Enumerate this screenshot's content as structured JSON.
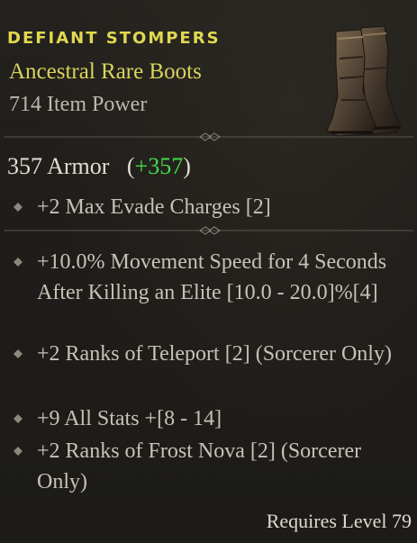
{
  "item": {
    "name": "DEFIANT STOMPERS",
    "type": "Ancestral Rare Boots",
    "power": "714 Item Power",
    "image_icon": "boots-icon"
  },
  "armor": {
    "value": "357 Armor",
    "bonus_open": "(",
    "bonus_value": "+357",
    "bonus_close": ")"
  },
  "implicit_affixes": [
    "+2 Max Evade Charges [2]"
  ],
  "affixes": [
    "+10.0% Movement Speed for 4 Seconds After Killing an Elite [10.0 - 20.0]%[4]",
    "+2 Ranks of Teleport [2] (Sorcerer Only)",
    "+9 All Stats +[8 - 14]",
    "+2 Ranks of Frost Nova [2] (Sorcerer Only)"
  ],
  "requirement": "Requires Level 79",
  "colors": {
    "name": "#e0d94f",
    "type": "#d9d45a",
    "bonus": "#43d94a",
    "text": "#c7c2b6",
    "background": "#1f1d1a"
  }
}
